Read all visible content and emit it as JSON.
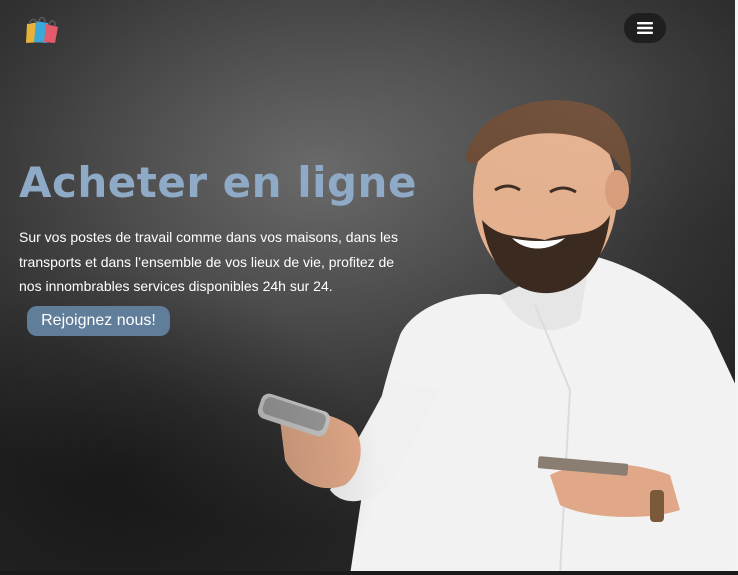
{
  "header": {
    "logo_icon": "shopping-bags-icon",
    "menu_icon": "hamburger-icon"
  },
  "hero": {
    "title": "Acheter en ligne",
    "description": "Sur vos postes de travail comme dans vos maisons, dans les transports et dans l’ensemble de vos lieux de vie, profitez de nos innombrables services disponibles 24h sur 24.",
    "cta_label": "Rejoignez nous!",
    "image_icon": "man-with-phone-and-card-image"
  },
  "colors": {
    "title": "#8faac6",
    "cta_background": "#607d99",
    "menu_background": "#1f1f1f"
  }
}
